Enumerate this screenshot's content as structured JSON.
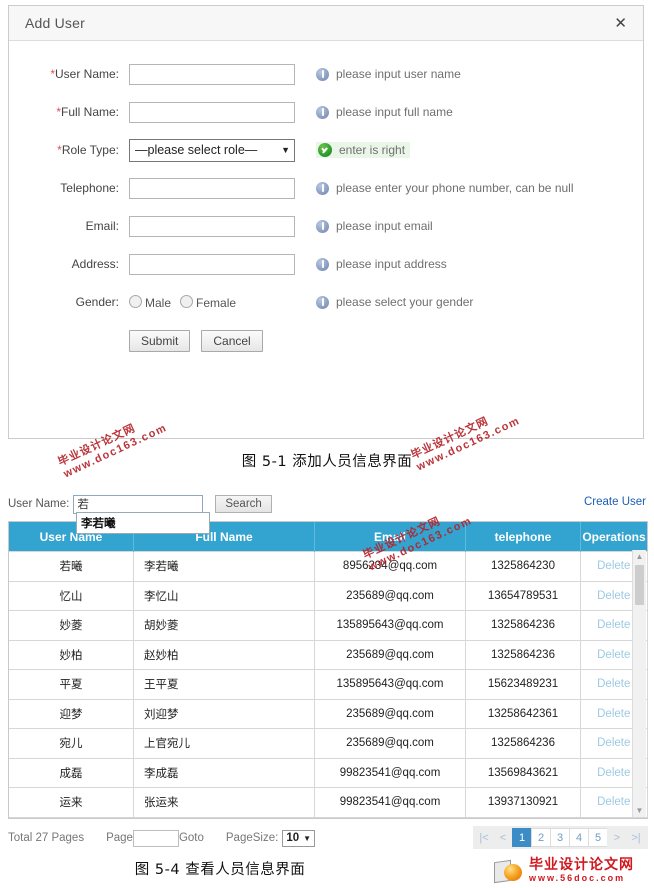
{
  "modal": {
    "title": "Add User",
    "close_icon": "close-icon",
    "fields": [
      {
        "required": true,
        "label": "User Name:",
        "value": "",
        "hint": "please input user name",
        "hint_state": "info",
        "control": "input"
      },
      {
        "required": true,
        "label": "Full Name:",
        "value": "",
        "hint": "please input full name",
        "hint_state": "info",
        "control": "input"
      },
      {
        "required": true,
        "label": "Role Type:",
        "value": "—please select role—",
        "hint": "enter is right",
        "hint_state": "ok",
        "control": "select"
      },
      {
        "required": false,
        "label": "Telephone:",
        "value": "",
        "hint": "please enter your phone number, can be null",
        "hint_state": "info",
        "control": "input"
      },
      {
        "required": false,
        "label": "Email:",
        "value": "",
        "hint": "please input email",
        "hint_state": "info",
        "control": "input"
      },
      {
        "required": false,
        "label": "Address:",
        "value": "",
        "hint": "please input address",
        "hint_state": "info",
        "control": "input"
      },
      {
        "required": false,
        "label": "Gender:",
        "value": "",
        "hint": "please select your gender",
        "hint_state": "info",
        "control": "radio"
      }
    ],
    "gender_options": [
      "Male",
      "Female"
    ],
    "submit_label": "Submit",
    "cancel_label": "Cancel"
  },
  "captions": {
    "figure_1": "图 5-1  添加人员信息界面",
    "figure_4": "图 5-4  查看人员信息界面"
  },
  "search": {
    "label": "User Name:",
    "value": "若",
    "placeholder": "",
    "button_label": "Search",
    "create_link": "Create User",
    "autocomplete": [
      "李若曦"
    ]
  },
  "table": {
    "columns": [
      "User Name",
      "Full Name",
      "Email",
      "telephone",
      "Operations"
    ],
    "header_bg": "#33a3cf",
    "delete_label": "Delete",
    "rows": [
      {
        "user": "若曦",
        "full": "李若曦",
        "email": "8956234@qq.com",
        "tel": "1325864230",
        "op": "Delete"
      },
      {
        "user": "忆山",
        "full": "李忆山",
        "email": "235689@qq.com",
        "tel": "13654789531",
        "op": "Delete"
      },
      {
        "user": "妙菱",
        "full": "胡妙菱",
        "email": "135895643@qq.com",
        "tel": "1325864236",
        "op": "Delete"
      },
      {
        "user": "妙柏",
        "full": "赵妙柏",
        "email": "235689@qq.com",
        "tel": "1325864236",
        "op": "Delete"
      },
      {
        "user": "平夏",
        "full": "王平夏",
        "email": "135895643@qq.com",
        "tel": "15623489231",
        "op": "Delete"
      },
      {
        "user": "迎梦",
        "full": "刘迎梦",
        "email": "235689@qq.com",
        "tel": "13258642361",
        "op": "Delete"
      },
      {
        "user": "宛儿",
        "full": "上官宛儿",
        "email": "235689@qq.com",
        "tel": "1325864236",
        "op": "Delete"
      },
      {
        "user": "成磊",
        "full": "李成磊",
        "email": "99823541@qq.com",
        "tel": "13569843621",
        "op": "Delete"
      },
      {
        "user": "运来",
        "full": "张运来",
        "email": "99823541@qq.com",
        "tel": "13937130921",
        "op": "Delete"
      }
    ]
  },
  "pager": {
    "total_text": "Total 27 Pages",
    "page_label": "Page",
    "page_value": "",
    "goto_label": "Goto",
    "pagesize_label": "PageSize:",
    "pagesize_value": "10",
    "buttons": [
      "|<",
      "<",
      "1",
      "2",
      "3",
      "4",
      "5",
      ">",
      ">|"
    ],
    "active_page": "1",
    "active_color": "#3c8dc5"
  },
  "watermarks": {
    "line1": "毕业设计论文网",
    "line2": "www.doc163.com",
    "color": "#b5242c"
  },
  "logo": {
    "name": "毕业设计论文网",
    "url": "www.56doc.com"
  }
}
